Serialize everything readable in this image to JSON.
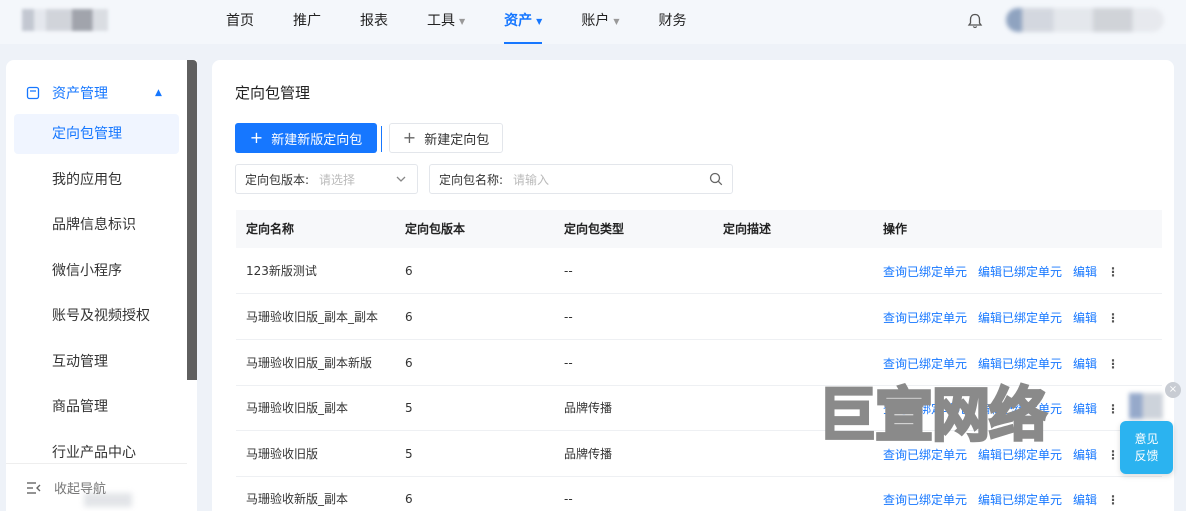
{
  "topbar": {
    "nav": [
      {
        "label": "首页",
        "caret": false,
        "active": false
      },
      {
        "label": "推广",
        "caret": false,
        "active": false
      },
      {
        "label": "报表",
        "caret": false,
        "active": false
      },
      {
        "label": "工具",
        "caret": true,
        "active": false
      },
      {
        "label": "资产",
        "caret": true,
        "active": true
      },
      {
        "label": "账户",
        "caret": true,
        "active": false
      },
      {
        "label": "财务",
        "caret": false,
        "active": false
      }
    ],
    "accent": "#1677ff"
  },
  "sidebar": {
    "group_label": "资产管理",
    "items": [
      {
        "label": "定向包管理",
        "active": true
      },
      {
        "label": "我的应用包",
        "active": false
      },
      {
        "label": "品牌信息标识",
        "active": false
      },
      {
        "label": "微信小程序",
        "active": false
      },
      {
        "label": "账号及视频授权",
        "active": false
      },
      {
        "label": "互动管理",
        "active": false
      },
      {
        "label": "商品管理",
        "active": false
      },
      {
        "label": "行业产品中心",
        "active": false
      }
    ],
    "collapse_label": "收起导航"
  },
  "main": {
    "title": "定向包管理",
    "primary_button": "新建新版定向包",
    "secondary_button": "新建定向包",
    "filters": {
      "version_label": "定向包版本:",
      "version_placeholder": "请选择",
      "name_label": "定向包名称:",
      "name_placeholder": "请输入"
    },
    "table": {
      "columns": [
        "定向名称",
        "定向包版本",
        "定向包类型",
        "定向描述",
        "操作"
      ],
      "actions": [
        "查询已绑定单元",
        "编辑已绑定单元",
        "编辑"
      ],
      "rows": [
        {
          "name": "123新版测试",
          "version": "6",
          "type": "--",
          "desc": ""
        },
        {
          "name": "马珊验收旧版_副本_副本",
          "version": "6",
          "type": "--",
          "desc": ""
        },
        {
          "name": "马珊验收旧版_副本新版",
          "version": "6",
          "type": "--",
          "desc": ""
        },
        {
          "name": "马珊验收旧版_副本",
          "version": "5",
          "type": "品牌传播",
          "desc": ""
        },
        {
          "name": "马珊验收旧版",
          "version": "5",
          "type": "品牌传播",
          "desc": ""
        },
        {
          "name": "马珊验收新版_副本",
          "version": "6",
          "type": "--",
          "desc": ""
        }
      ]
    }
  },
  "watermark": "巨宣网络",
  "feedback": {
    "line1": "意见",
    "line2": "反馈",
    "close": "×"
  }
}
